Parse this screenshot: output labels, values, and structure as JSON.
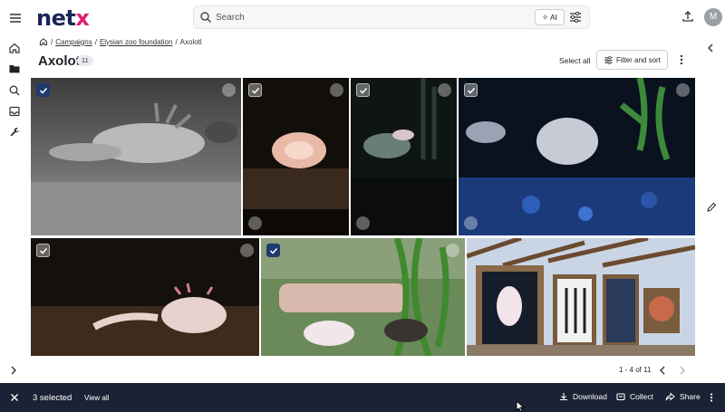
{
  "header": {
    "logo_main": "net",
    "logo_accent": "x",
    "search_placeholder": "Search",
    "ai_label": "AI",
    "avatar_initial": "M"
  },
  "breadcrumb": {
    "separator": "/",
    "items": [
      "Campaigns",
      "Elysian zoo foundation"
    ],
    "current": "Axolotl"
  },
  "page": {
    "title": "Axolotl",
    "count": "11",
    "select_all": "Select all",
    "filter_label": "Filter and sort"
  },
  "tiles": [
    {
      "selected": true
    },
    {
      "selected": false
    },
    {
      "selected": false
    },
    {
      "selected": false
    },
    {
      "selected": false
    },
    {
      "selected": true
    },
    {
      "selected": false
    }
  ],
  "pagination": {
    "range": "1 - 4 of 11"
  },
  "footer": {
    "selected_text": "3 selected",
    "view_all": "View all",
    "download": "Download",
    "collect": "Collect",
    "share": "Share"
  }
}
